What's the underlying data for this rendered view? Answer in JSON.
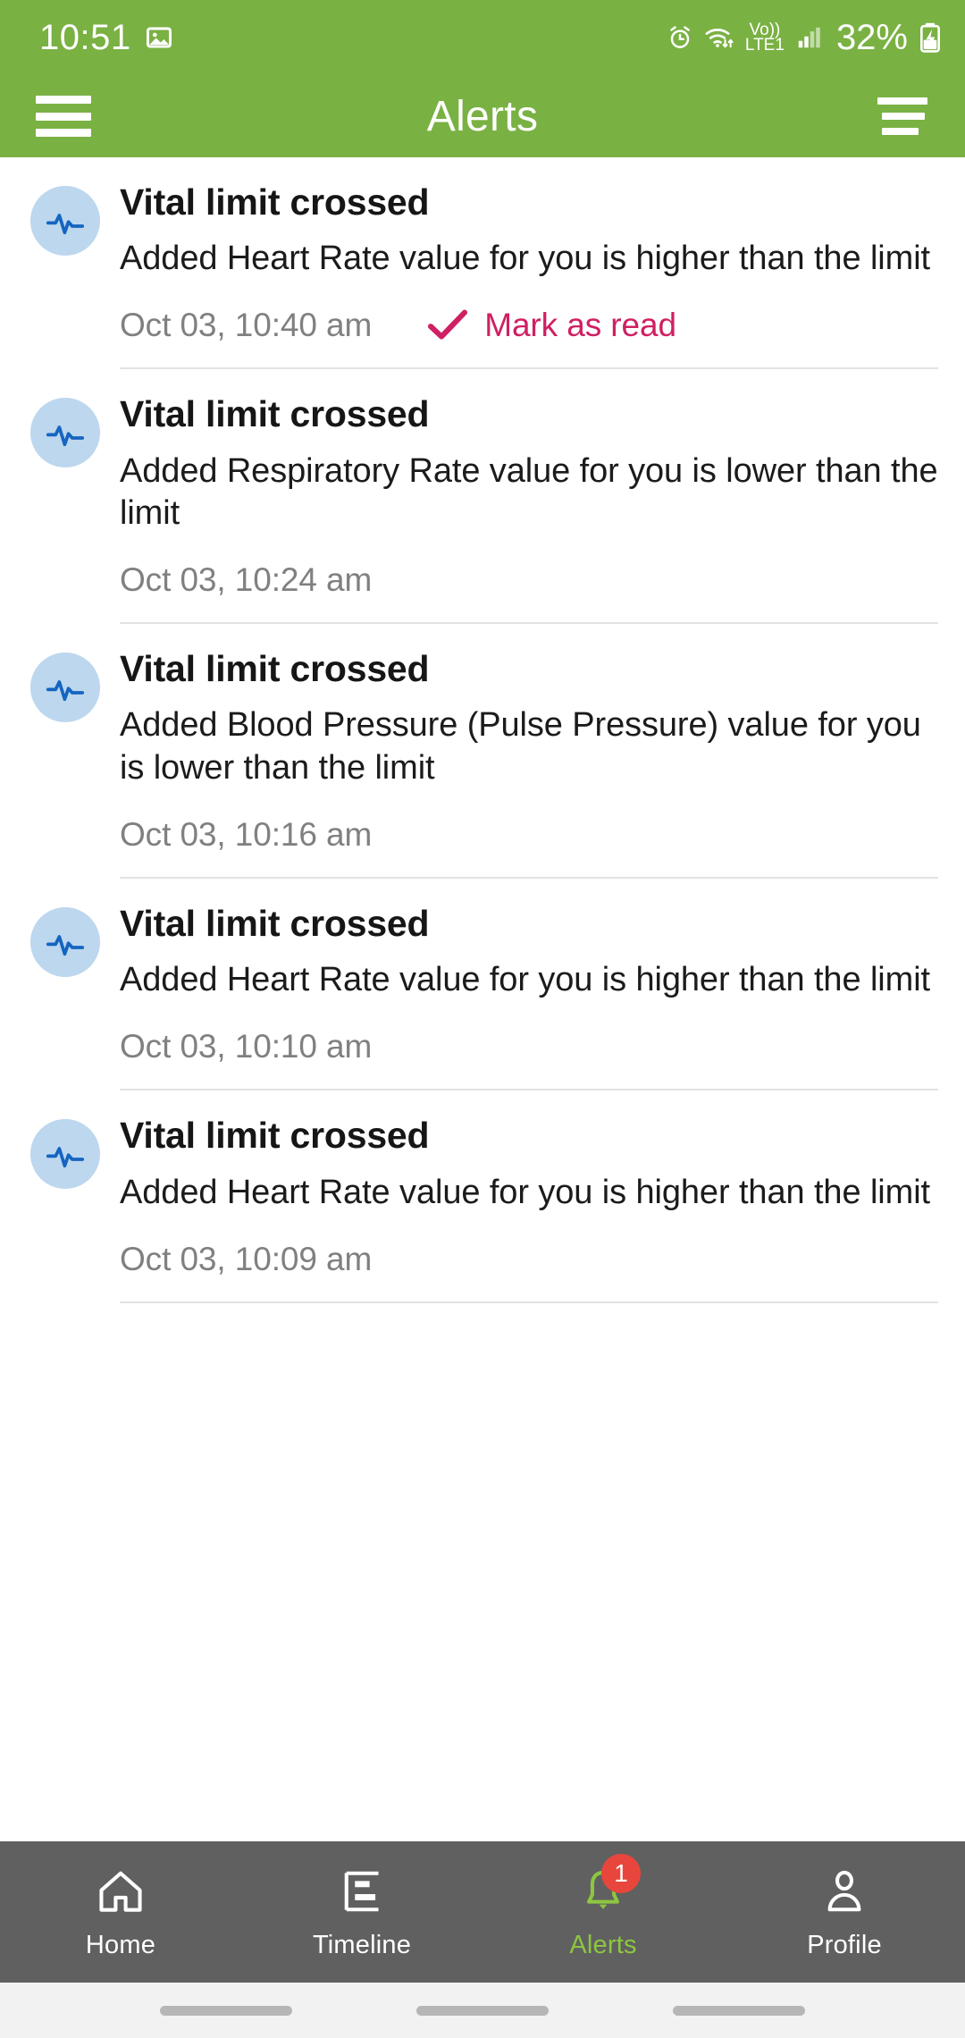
{
  "status_bar": {
    "time": "10:51",
    "battery_percent": "32%",
    "network_label_top": "Vo))",
    "network_label_bottom": "LTE1",
    "icons": [
      "image-icon",
      "alarm-icon",
      "wifi-icon",
      "volte-icon",
      "signal-icon",
      "battery-charging-icon"
    ]
  },
  "header": {
    "title": "Alerts",
    "menu_icon": "hamburger-menu-icon",
    "sort_icon": "sort-filter-icon",
    "background_color": "#7ab143"
  },
  "colors": {
    "brand_green": "#7ab143",
    "accent_pink": "#cf2063",
    "avatar_bg": "#bcd7ee",
    "avatar_fg": "#1565c0",
    "nav_bg": "#606060",
    "nav_active": "#8dc63f",
    "badge_red": "#e8463c",
    "muted_text": "#808080",
    "divider": "#e2e2e2"
  },
  "alerts": [
    {
      "icon": "vitals-pulse-icon",
      "title": "Vital limit crossed",
      "description": "Added Heart Rate value for you is higher than the limit",
      "timestamp": "Oct 03, 10:40 am",
      "mark_as_read_label": "Mark as read",
      "has_mark_as_read": true
    },
    {
      "icon": "vitals-pulse-icon",
      "title": "Vital limit crossed",
      "description": "Added Respiratory Rate value for you is lower than the limit",
      "timestamp": "Oct 03, 10:24 am",
      "mark_as_read_label": "",
      "has_mark_as_read": false
    },
    {
      "icon": "vitals-pulse-icon",
      "title": "Vital limit crossed",
      "description": "Added Blood Pressure (Pulse Pressure) value for you is lower than the limit",
      "timestamp": "Oct 03, 10:16 am",
      "mark_as_read_label": "",
      "has_mark_as_read": false
    },
    {
      "icon": "vitals-pulse-icon",
      "title": "Vital limit crossed",
      "description": "Added Heart Rate value for you is higher than the limit",
      "timestamp": "Oct 03, 10:10 am",
      "mark_as_read_label": "",
      "has_mark_as_read": false
    },
    {
      "icon": "vitals-pulse-icon",
      "title": "Vital limit crossed",
      "description": "Added Heart Rate value for you is higher than the limit",
      "timestamp": "Oct 03, 10:09 am",
      "mark_as_read_label": "",
      "has_mark_as_read": false
    }
  ],
  "bottom_nav": {
    "items": [
      {
        "label": "Home",
        "icon": "home-icon",
        "active": false,
        "badge": ""
      },
      {
        "label": "Timeline",
        "icon": "timeline-icon",
        "active": false,
        "badge": ""
      },
      {
        "label": "Alerts",
        "icon": "bell-icon",
        "active": true,
        "badge": "1"
      },
      {
        "label": "Profile",
        "icon": "person-icon",
        "active": false,
        "badge": ""
      }
    ]
  }
}
